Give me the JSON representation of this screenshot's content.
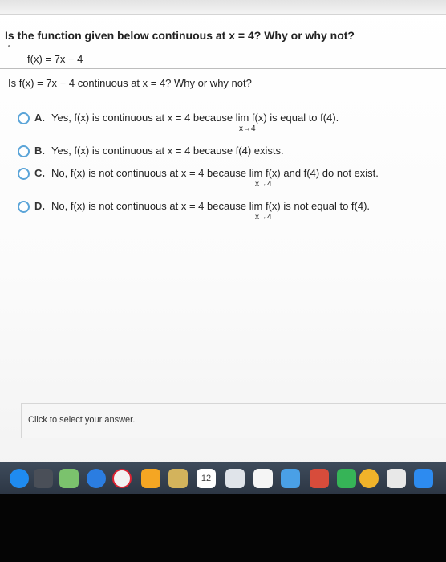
{
  "question": {
    "title": "Is the function given below continuous at x = 4? Why or why not?",
    "function": "f(x) = 7x − 4",
    "prompt": "Is f(x) = 7x − 4 continuous at x = 4? Why or why not?"
  },
  "options": [
    {
      "letter": "A.",
      "text": "Yes, f(x) is continuous at x = 4 because  lim f(x) is equal to f(4).",
      "limit_sub": "x→4"
    },
    {
      "letter": "B.",
      "text": "Yes, f(x) is continuous at x = 4 because f(4) exists.",
      "limit_sub": ""
    },
    {
      "letter": "C.",
      "text": "No, f(x) is not continuous at x = 4 because  lim f(x) and f(4) do not exist.",
      "limit_sub": "x→4"
    },
    {
      "letter": "D.",
      "text": "No, f(x) is not continuous at x = 4 because  lim f(x) is not equal to f(4).",
      "limit_sub": "x→4"
    }
  ],
  "answer_hint": "Click to select your answer.",
  "dock": {
    "calendar_day": "12"
  }
}
